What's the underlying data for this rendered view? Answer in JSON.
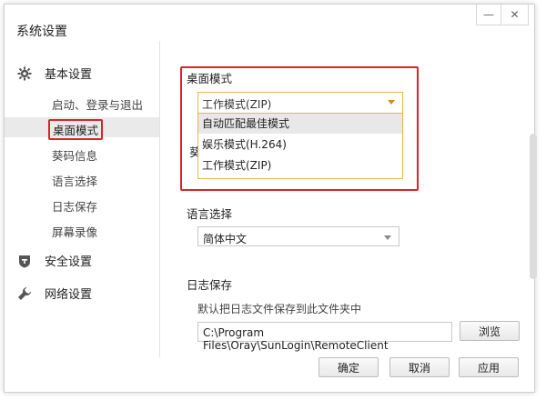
{
  "window": {
    "title": "系统设置",
    "minimize_glyph": "—",
    "close_glyph": "✕"
  },
  "sidebar": {
    "groups": [
      {
        "label": "基本设置",
        "icon": "gear-icon"
      },
      {
        "label": "安全设置",
        "icon": "shield-icon"
      },
      {
        "label": "网络设置",
        "icon": "wrench-icon"
      }
    ],
    "subitems": [
      "启动、登录与退出",
      "桌面模式",
      "葵码信息",
      "语言选择",
      "日志保存",
      "屏幕录像"
    ],
    "active": "桌面模式"
  },
  "desktop_mode": {
    "title": "桌面模式",
    "selected": "工作模式(ZIP)",
    "options": [
      "自动匹配最佳模式",
      "娱乐模式(H.264)",
      "工作模式(ZIP)"
    ],
    "hovered_option": "自动匹配最佳模式",
    "partially_hidden_label": "葵"
  },
  "language": {
    "title": "语言选择",
    "selected": "简体中文"
  },
  "log": {
    "title": "日志保存",
    "description": "默认把日志文件保存到此文件夹中",
    "path": "C:\\Program Files\\Oray\\SunLogin\\RemoteClient",
    "browse_label": "浏览"
  },
  "footer": {
    "ok_label": "确定",
    "cancel_label": "取消",
    "apply_label": "应用"
  },
  "colors": {
    "highlight_red": "#d9232b",
    "dropdown_border": "#e0b84a"
  }
}
